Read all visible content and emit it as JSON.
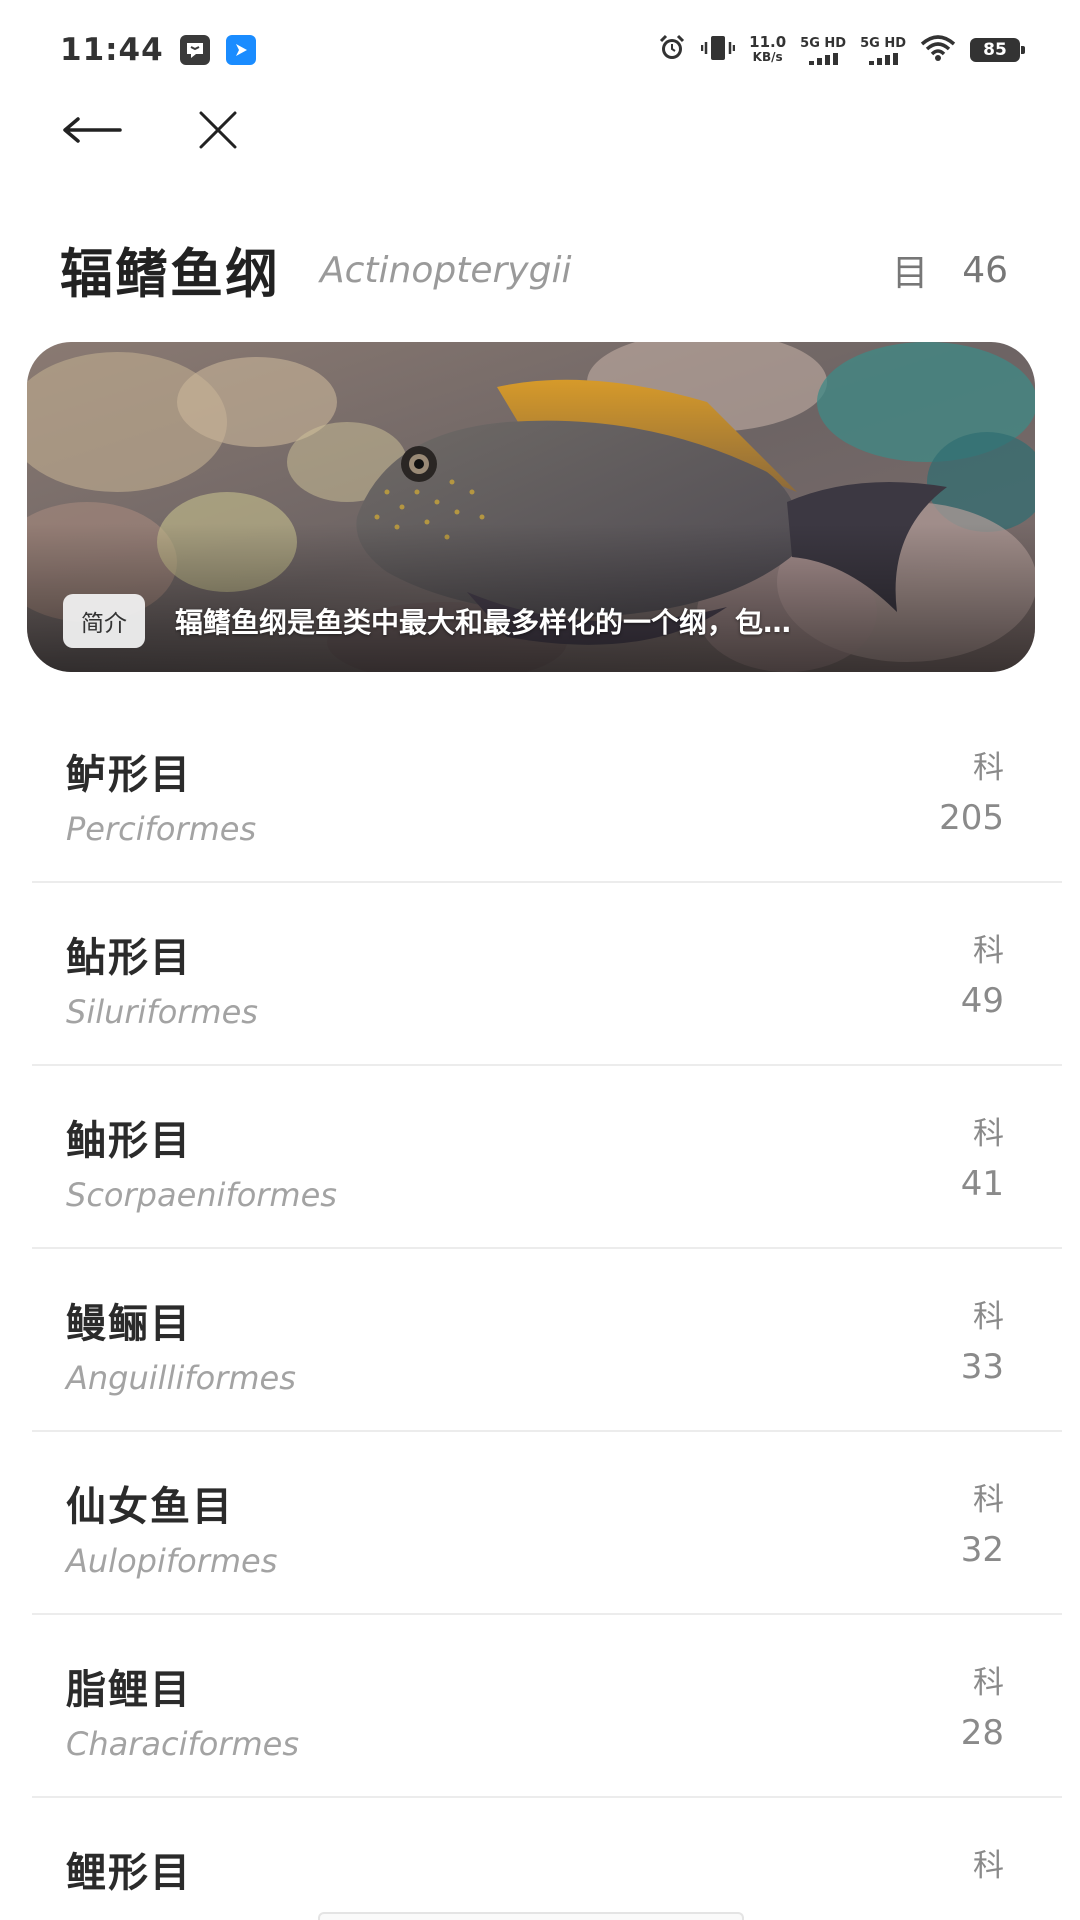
{
  "status_bar": {
    "time": "11:44",
    "net_speed_value": "11.0",
    "net_speed_unit": "KB/s",
    "sim1_label": "5G HD",
    "sim2_label": "5G HD",
    "battery": "85",
    "icons": [
      "message-app-icon",
      "navigation-app-icon",
      "alarm-icon",
      "vibrate-icon",
      "wifi-icon",
      "battery-icon"
    ]
  },
  "nav": {
    "back_icon": "arrow-left-icon",
    "close_icon": "close-icon"
  },
  "header": {
    "title": "辐鳍鱼纲",
    "latin": "Actinopterygii",
    "count_label": "目",
    "count_value": "46"
  },
  "banner": {
    "badge": "简介",
    "text": "辐鳍鱼纲是鱼类中最大和最多样化的一个纲，包…"
  },
  "orders": [
    {
      "name": "鲈形目",
      "latin": "Perciformes",
      "unit": "科",
      "count": "205"
    },
    {
      "name": "鲇形目",
      "latin": "Siluriformes",
      "unit": "科",
      "count": "49"
    },
    {
      "name": "鲉形目",
      "latin": "Scorpaeniformes",
      "unit": "科",
      "count": "41"
    },
    {
      "name": "鳗鲡目",
      "latin": "Anguilliformes",
      "unit": "科",
      "count": "33"
    },
    {
      "name": "仙女鱼目",
      "latin": "Aulopiformes",
      "unit": "科",
      "count": "32"
    },
    {
      "name": "脂鲤目",
      "latin": "Characiformes",
      "unit": "科",
      "count": "28"
    },
    {
      "name": "鲤形目",
      "latin": "",
      "unit": "科",
      "count": ""
    }
  ]
}
